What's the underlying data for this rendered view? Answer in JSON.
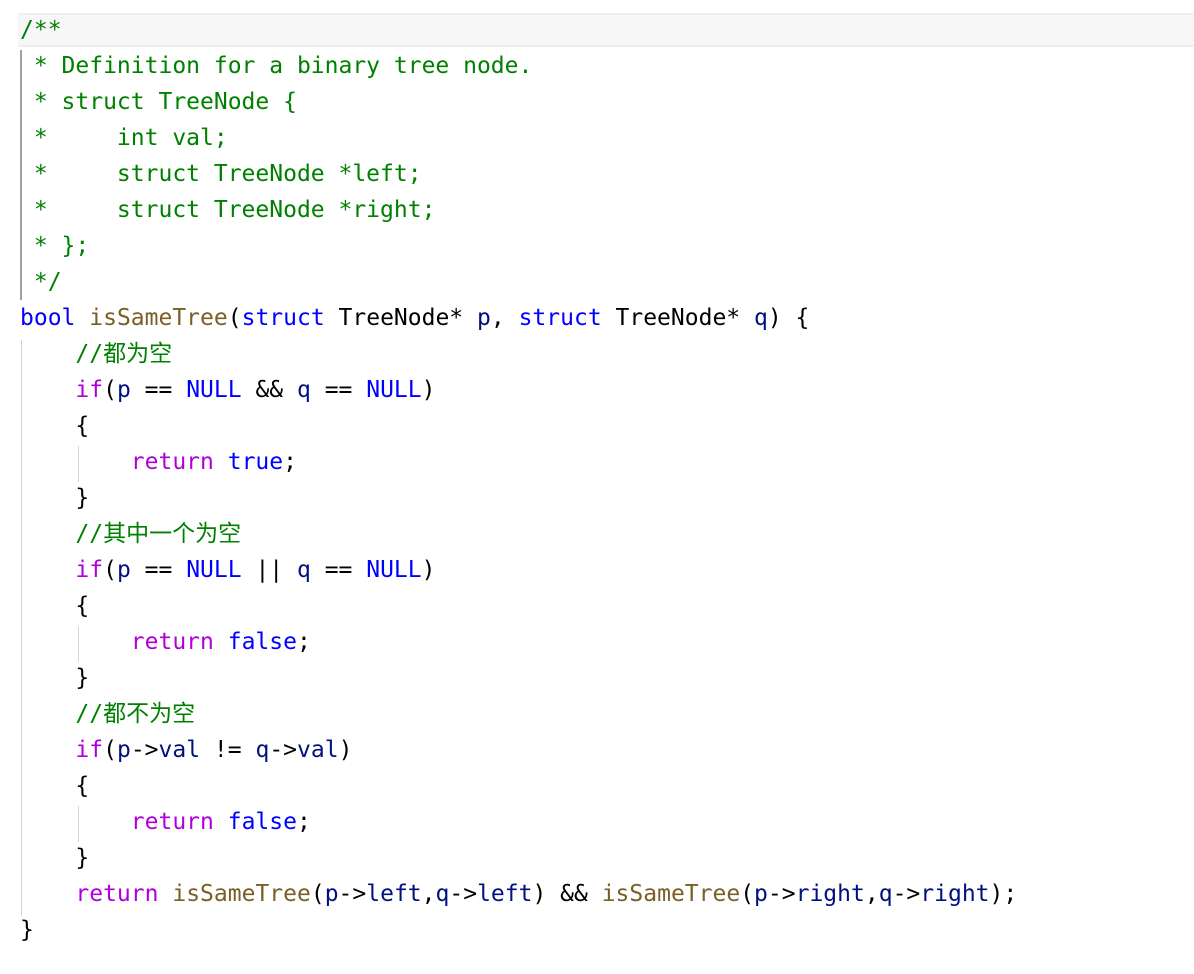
{
  "editor": {
    "colors": {
      "comment": "#008000",
      "keyword": "#0000ff",
      "control": "#af00db",
      "function": "#795e26",
      "variable": "#001080",
      "text": "#000000",
      "guide": "#d3d3d3",
      "line_highlight": "#f7f7f7"
    },
    "lines": [
      [
        {
          "t": "/**",
          "c": "cm"
        }
      ],
      [
        {
          "t": " * Definition for a binary tree node.",
          "c": "cm"
        }
      ],
      [
        {
          "t": " * struct TreeNode {",
          "c": "cm"
        }
      ],
      [
        {
          "t": " *     int val;",
          "c": "cm"
        }
      ],
      [
        {
          "t": " *     struct TreeNode *left;",
          "c": "cm"
        }
      ],
      [
        {
          "t": " *     struct TreeNode *right;",
          "c": "cm"
        }
      ],
      [
        {
          "t": " * };",
          "c": "cm"
        }
      ],
      [
        {
          "t": " */",
          "c": "cm"
        }
      ],
      [
        {
          "t": "bool",
          "c": "kw"
        },
        {
          "t": " ",
          "c": "plain"
        },
        {
          "t": "isSameTree",
          "c": "fn"
        },
        {
          "t": "(",
          "c": "plain"
        },
        {
          "t": "struct",
          "c": "kw"
        },
        {
          "t": " TreeNode* ",
          "c": "plain"
        },
        {
          "t": "p",
          "c": "var"
        },
        {
          "t": ", ",
          "c": "plain"
        },
        {
          "t": "struct",
          "c": "kw"
        },
        {
          "t": " TreeNode* ",
          "c": "plain"
        },
        {
          "t": "q",
          "c": "var"
        },
        {
          "t": ") {",
          "c": "plain"
        }
      ],
      [
        {
          "t": "    //都为空",
          "c": "cm"
        }
      ],
      [
        {
          "t": "    ",
          "c": "plain"
        },
        {
          "t": "if",
          "c": "ctl"
        },
        {
          "t": "(",
          "c": "plain"
        },
        {
          "t": "p",
          "c": "var"
        },
        {
          "t": " == ",
          "c": "plain"
        },
        {
          "t": "NULL",
          "c": "kw"
        },
        {
          "t": " && ",
          "c": "plain"
        },
        {
          "t": "q",
          "c": "var"
        },
        {
          "t": " == ",
          "c": "plain"
        },
        {
          "t": "NULL",
          "c": "kw"
        },
        {
          "t": ")",
          "c": "plain"
        }
      ],
      [
        {
          "t": "    {",
          "c": "plain"
        }
      ],
      [
        {
          "t": "        ",
          "c": "plain"
        },
        {
          "t": "return",
          "c": "ctl"
        },
        {
          "t": " ",
          "c": "plain"
        },
        {
          "t": "true",
          "c": "kw"
        },
        {
          "t": ";",
          "c": "plain"
        }
      ],
      [
        {
          "t": "    }",
          "c": "plain"
        }
      ],
      [
        {
          "t": "    //其中一个为空",
          "c": "cm"
        }
      ],
      [
        {
          "t": "    ",
          "c": "plain"
        },
        {
          "t": "if",
          "c": "ctl"
        },
        {
          "t": "(",
          "c": "plain"
        },
        {
          "t": "p",
          "c": "var"
        },
        {
          "t": " == ",
          "c": "plain"
        },
        {
          "t": "NULL",
          "c": "kw"
        },
        {
          "t": " || ",
          "c": "plain"
        },
        {
          "t": "q",
          "c": "var"
        },
        {
          "t": " == ",
          "c": "plain"
        },
        {
          "t": "NULL",
          "c": "kw"
        },
        {
          "t": ")",
          "c": "plain"
        }
      ],
      [
        {
          "t": "    {",
          "c": "plain"
        }
      ],
      [
        {
          "t": "        ",
          "c": "plain"
        },
        {
          "t": "return",
          "c": "ctl"
        },
        {
          "t": " ",
          "c": "plain"
        },
        {
          "t": "false",
          "c": "kw"
        },
        {
          "t": ";",
          "c": "plain"
        }
      ],
      [
        {
          "t": "    }",
          "c": "plain"
        }
      ],
      [
        {
          "t": "    //都不为空",
          "c": "cm"
        }
      ],
      [
        {
          "t": "    ",
          "c": "plain"
        },
        {
          "t": "if",
          "c": "ctl"
        },
        {
          "t": "(",
          "c": "plain"
        },
        {
          "t": "p",
          "c": "var"
        },
        {
          "t": "->",
          "c": "plain"
        },
        {
          "t": "val",
          "c": "var"
        },
        {
          "t": " != ",
          "c": "plain"
        },
        {
          "t": "q",
          "c": "var"
        },
        {
          "t": "->",
          "c": "plain"
        },
        {
          "t": "val",
          "c": "var"
        },
        {
          "t": ")",
          "c": "plain"
        }
      ],
      [
        {
          "t": "    {",
          "c": "plain"
        }
      ],
      [
        {
          "t": "        ",
          "c": "plain"
        },
        {
          "t": "return",
          "c": "ctl"
        },
        {
          "t": " ",
          "c": "plain"
        },
        {
          "t": "false",
          "c": "kw"
        },
        {
          "t": ";",
          "c": "plain"
        }
      ],
      [
        {
          "t": "    }",
          "c": "plain"
        }
      ],
      [
        {
          "t": "    ",
          "c": "plain"
        },
        {
          "t": "return",
          "c": "ctl"
        },
        {
          "t": " ",
          "c": "plain"
        },
        {
          "t": "isSameTree",
          "c": "fn"
        },
        {
          "t": "(",
          "c": "plain"
        },
        {
          "t": "p",
          "c": "var"
        },
        {
          "t": "->",
          "c": "plain"
        },
        {
          "t": "left",
          "c": "var"
        },
        {
          "t": ",",
          "c": "plain"
        },
        {
          "t": "q",
          "c": "var"
        },
        {
          "t": "->",
          "c": "plain"
        },
        {
          "t": "left",
          "c": "var"
        },
        {
          "t": ") && ",
          "c": "plain"
        },
        {
          "t": "isSameTree",
          "c": "fn"
        },
        {
          "t": "(",
          "c": "plain"
        },
        {
          "t": "p",
          "c": "var"
        },
        {
          "t": "->",
          "c": "plain"
        },
        {
          "t": "right",
          "c": "var"
        },
        {
          "t": ",",
          "c": "plain"
        },
        {
          "t": "q",
          "c": "var"
        },
        {
          "t": "->",
          "c": "plain"
        },
        {
          "t": "right",
          "c": "var"
        },
        {
          "t": ");",
          "c": "plain"
        }
      ],
      [
        {
          "t": "}",
          "c": "plain"
        }
      ]
    ]
  }
}
